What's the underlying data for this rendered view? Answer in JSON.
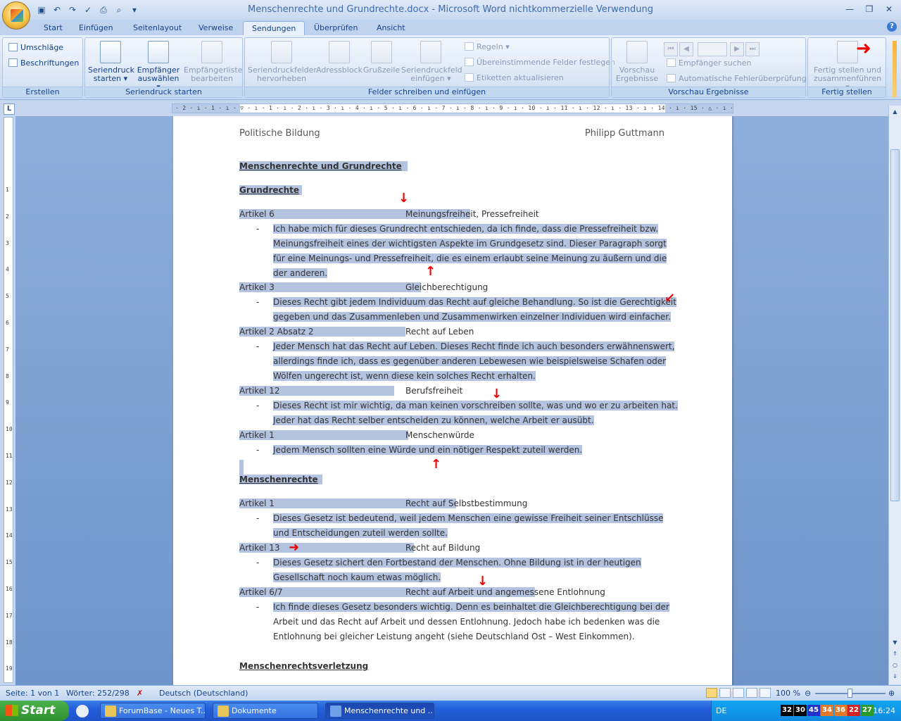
{
  "window": {
    "title": "Menschenrechte und Grundrechte.docx - Microsoft Word nichtkommerzielle Verwendung"
  },
  "tabs": [
    "Start",
    "Einfügen",
    "Seitenlayout",
    "Verweise",
    "Sendungen",
    "Überprüfen",
    "Ansicht"
  ],
  "active_tab": "Sendungen",
  "ribbon": {
    "erstellen": {
      "label": "Erstellen",
      "umschlaege": "Umschläge",
      "beschriftungen": "Beschriftungen"
    },
    "seriendruck": {
      "label": "Seriendruck starten",
      "seriendruck_starten_1": "Seriendruck",
      "seriendruck_starten_2": "starten",
      "empfaenger_1": "Empfänger",
      "empfaenger_2": "auswählen",
      "empfaengerliste_1": "Empfängerliste",
      "empfaengerliste_2": "bearbeiten"
    },
    "felder": {
      "label": "Felder schreiben und einfügen",
      "hervorheben_1": "Seriendruckfelder",
      "hervorheben_2": "hervorheben",
      "adressblock": "Adressblock",
      "grusszeile": "Grußzeile",
      "feld_1": "Seriendruckfeld",
      "feld_2": "einfügen",
      "regeln": "Regeln",
      "uebereinstimmende": "Übereinstimmende Felder festlegen",
      "etiketten": "Etiketten aktualisieren"
    },
    "vorschau": {
      "label": "Vorschau Ergebnisse",
      "vorschau_1": "Vorschau",
      "vorschau_2": "Ergebnisse",
      "empfaenger_suchen": "Empfänger suchen",
      "fehlerpruefung": "Automatische Fehlerüberprüfung"
    },
    "fertig": {
      "label": "Fertig stellen",
      "fertig_1": "Fertig stellen und",
      "fertig_2": "zusammenführen"
    }
  },
  "ruler": {
    "marks": "· 2 · ı · 1 · ı · ▽ · ı · 1 · ı · 2 · ı · 3 · ı · 4 · ı · 5 · ı · 6 · ı · 7 · ı · 8 · ı · 9 · ı · 10 · ı · 11 · ı · 12 · ı · 13 · ı · 14 · ı · 15 · △ · ı · 17 · ı · 18 ·",
    "vertical": [
      "1",
      "2",
      "3",
      "4",
      "5",
      "6",
      "7",
      "8",
      "9",
      "10",
      "11",
      "12",
      "13",
      "14",
      "15",
      "16",
      "17",
      "18",
      "19"
    ]
  },
  "document": {
    "header_left": "Politische Bildung",
    "header_right": "Philipp Guttmann",
    "title": "Menschenrechte und Grundrechte",
    "section1": "Grundrechte",
    "a1_left": "Artikel 6",
    "a1_right": "Meinungsfreiheit,  Pressefreiheit",
    "a1_l1": "Ich habe mich für dieses Grundrecht entschieden,  da ich finde,  dass die Pressefreiheit  bzw.",
    "a1_l2": "Meinungsfreiheit  eines  der wichtigsten  Aspekte  im Grundgesetz sind.  Dieser  Paragraph sorgt",
    "a1_l3": "für eine Meinungs-  und  Pressefreiheit,  die es einem  erlaubt seine Meinung  zu äußern und  die",
    "a1_l4": "der anderen.",
    "a2_left": "Artikel 3",
    "a2_right": "Gleichberechtigung",
    "a2_l1": "Dieses Recht gibt jedem Individuum  das Recht  auf gleiche Behandlung.  So ist die Gerechtigkeit",
    "a2_l2": "gegeben und das Zusammenleben  und Zusammenwirken  einzelner Individuen  wird einfacher.",
    "a3_left": "Artikel 2  Absatz  2",
    "a3_right": "Recht auf Leben",
    "a3_l1": "Jeder Mensch hat das Recht  auf Leben.  Dieses Recht finde ich auch  besonders erwähnenswert,",
    "a3_l2": "allerdings finde ich,  dass es gegenüber  anderen Lebewesen  wie beispielsweise Schafen  oder",
    "a3_l3": "Wölfen  ungerecht  ist,  wenn  diese kein  solches  Recht  erhalten.",
    "a4_left": "Artikel 12",
    "a4_right": "Berufsfreiheit",
    "a4_l1": "Dieses  Recht ist mir wichtig,  da man  keinen  vorschreiben sollte,  was und  wo er zu arbeiten hat.",
    "a4_l2": "Jeder hat das Recht  selber entscheiden  zu können,  welche  Arbeit er ausübt.",
    "a5_left": "Artikel 1",
    "a5_right": "Menschenwürde",
    "a5_l1": "Jedem Mensch  sollten  eine  Würde  und  ein nötiger  Respekt  zuteil werden.",
    "section2": "Menschenrechte",
    "b1_left": "Artikel 1",
    "b1_right": "Recht auf Selbstbestimmung",
    "b1_l1": "Dieses Gesetz ist bedeutend,  weil jedem Menschen  eine  gewisse  Freiheit seiner Entschlüsse",
    "b1_l2": "und Entscheidungen  zuteil  werden sollte.",
    "b2_left": "Artikel 13",
    "b2_right": "Recht auf Bildung",
    "b2_l1": "Dieses Gesetz sichert den Fortbestand  der Menschen.  Ohne  Bildung  ist in der heutigen",
    "b2_l2": "Gesellschaft  noch  kaum  etwas möglich.",
    "b3_left": "Artikel 6/7",
    "b3_right": "Recht auf Arbeit und angemessene  Entlohnung",
    "b3_l1": "Ich finde dieses  Gesetz besonders wichtig.  Denn es beinhaltet  die Gleichberechtigung  bei der",
    "b3_l2": "Arbeit und das Recht auf Arbeit und dessen Entlohnung.  Jedoch habe ich bedenken was die",
    "b3_l3": "Entlohnung  bei gleicher  Leistung  angeht (siehe  Deutschland  Ost – West Einkommen).",
    "section3": "Menschenrechtsverletzung",
    "dash": "-"
  },
  "statusbar": {
    "seite": "Seite: 1 von 1",
    "woerter": "Wörter: 252/298",
    "sprache": "Deutsch (Deutschland)",
    "zoom": "100 %"
  },
  "taskbar": {
    "start": "Start",
    "items": [
      "ForumBase - Neues T...",
      "Dokumente",
      "Menschenrechte und ..."
    ],
    "lang": "DE",
    "nums": [
      "32",
      "30",
      "45",
      "34",
      "36",
      "22",
      "27"
    ],
    "clock": "16:24"
  },
  "colors": {
    "selection": "#b4c4e0",
    "annotation_red": "#ee0000",
    "ribbon_blue": "#15428b"
  }
}
